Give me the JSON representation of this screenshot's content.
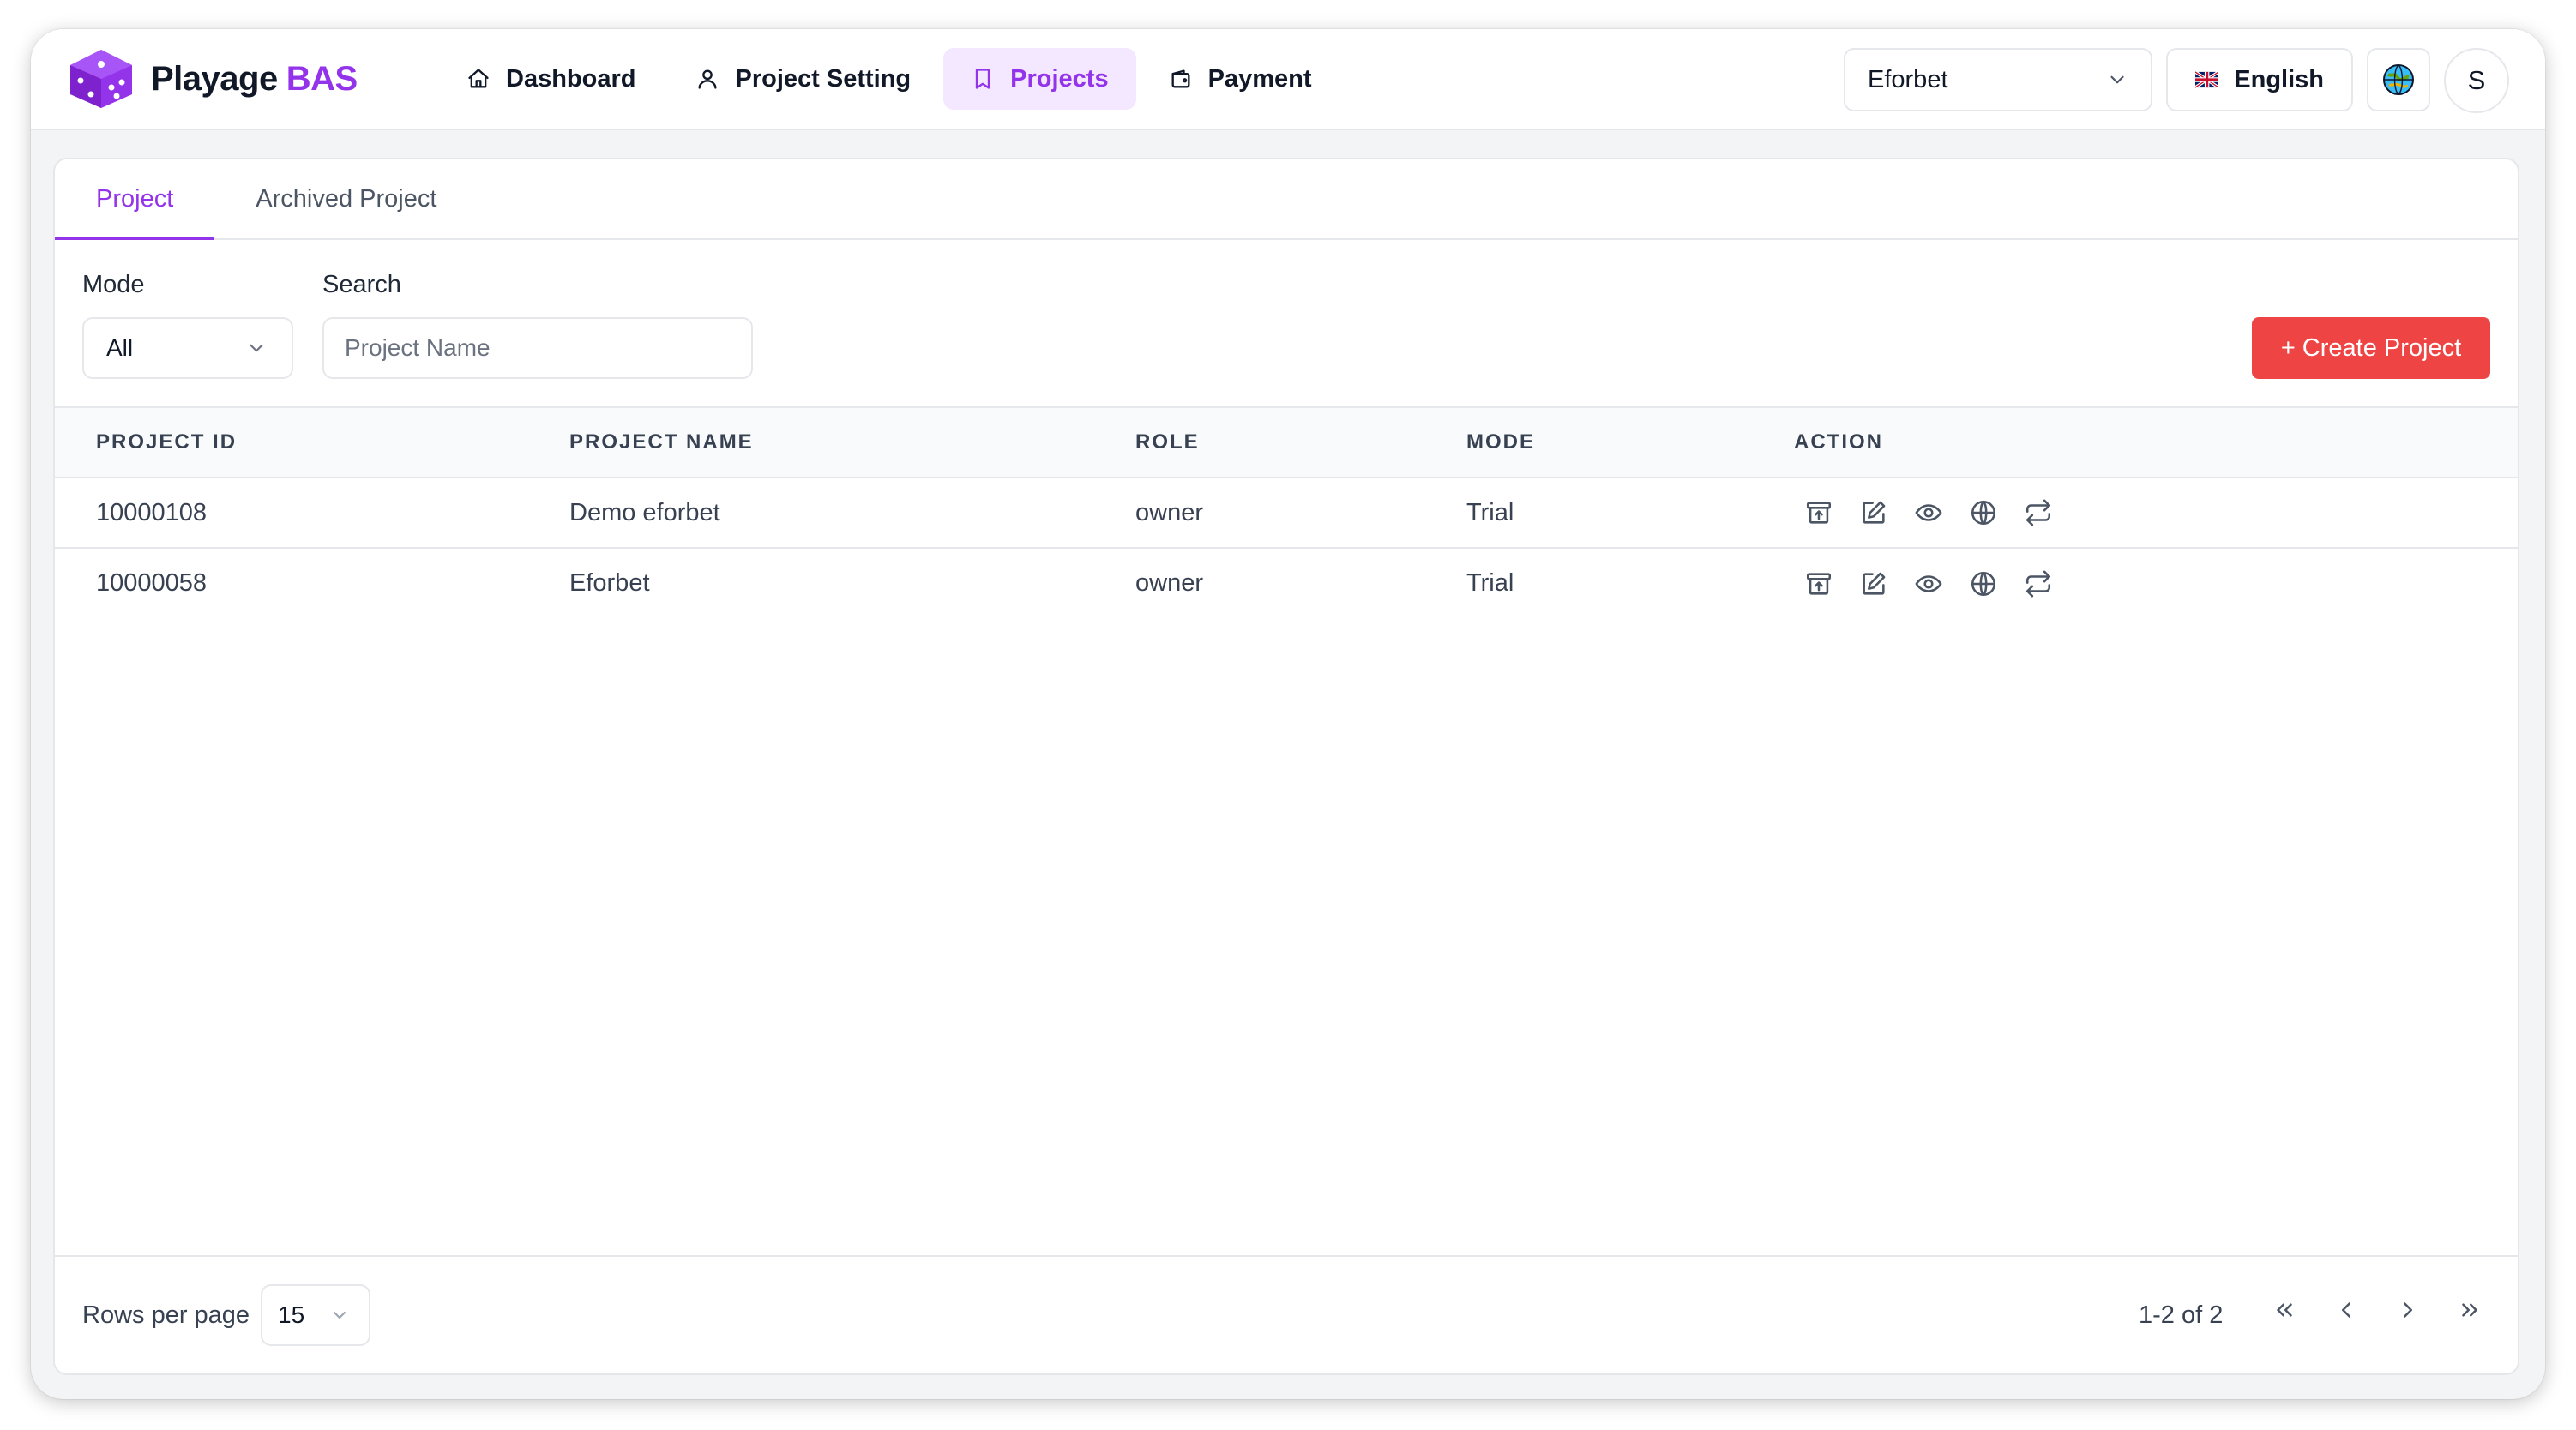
{
  "app": {
    "brand": "Playage",
    "brand_accent": "BAS"
  },
  "nav": [
    {
      "label": "Dashboard",
      "icon": "home-icon",
      "active": false
    },
    {
      "label": "Project Setting",
      "icon": "user-icon",
      "active": false
    },
    {
      "label": "Projects",
      "icon": "bookmark-icon",
      "active": true
    },
    {
      "label": "Payment",
      "icon": "wallet-icon",
      "active": false
    }
  ],
  "header": {
    "project_select": "Eforbet",
    "language": "English",
    "avatar_initial": "S"
  },
  "tabs": [
    {
      "label": "Project",
      "active": true
    },
    {
      "label": "Archived Project",
      "active": false
    }
  ],
  "filters": {
    "mode_label": "Mode",
    "mode_value": "All",
    "search_label": "Search",
    "search_placeholder": "Project Name",
    "create_button": "+ Create Project"
  },
  "table": {
    "columns": [
      "PROJECT ID",
      "PROJECT NAME",
      "ROLE",
      "MODE",
      "ACTION"
    ],
    "rows": [
      {
        "id": "10000108",
        "name": "Demo eforbet",
        "role": "owner",
        "mode": "Trial"
      },
      {
        "id": "10000058",
        "name": "Eforbet",
        "role": "owner",
        "mode": "Trial"
      }
    ],
    "action_icons": [
      "archive-icon",
      "edit-icon",
      "eye-icon",
      "globe-icon",
      "repeat-icon"
    ]
  },
  "footer": {
    "rows_per_page_label": "Rows per page",
    "rows_per_page_value": "15",
    "page_info": "1-2 of 2"
  },
  "colors": {
    "accent": "#9333ea",
    "accent_bg": "#f3e8ff",
    "danger": "#ef4444"
  }
}
